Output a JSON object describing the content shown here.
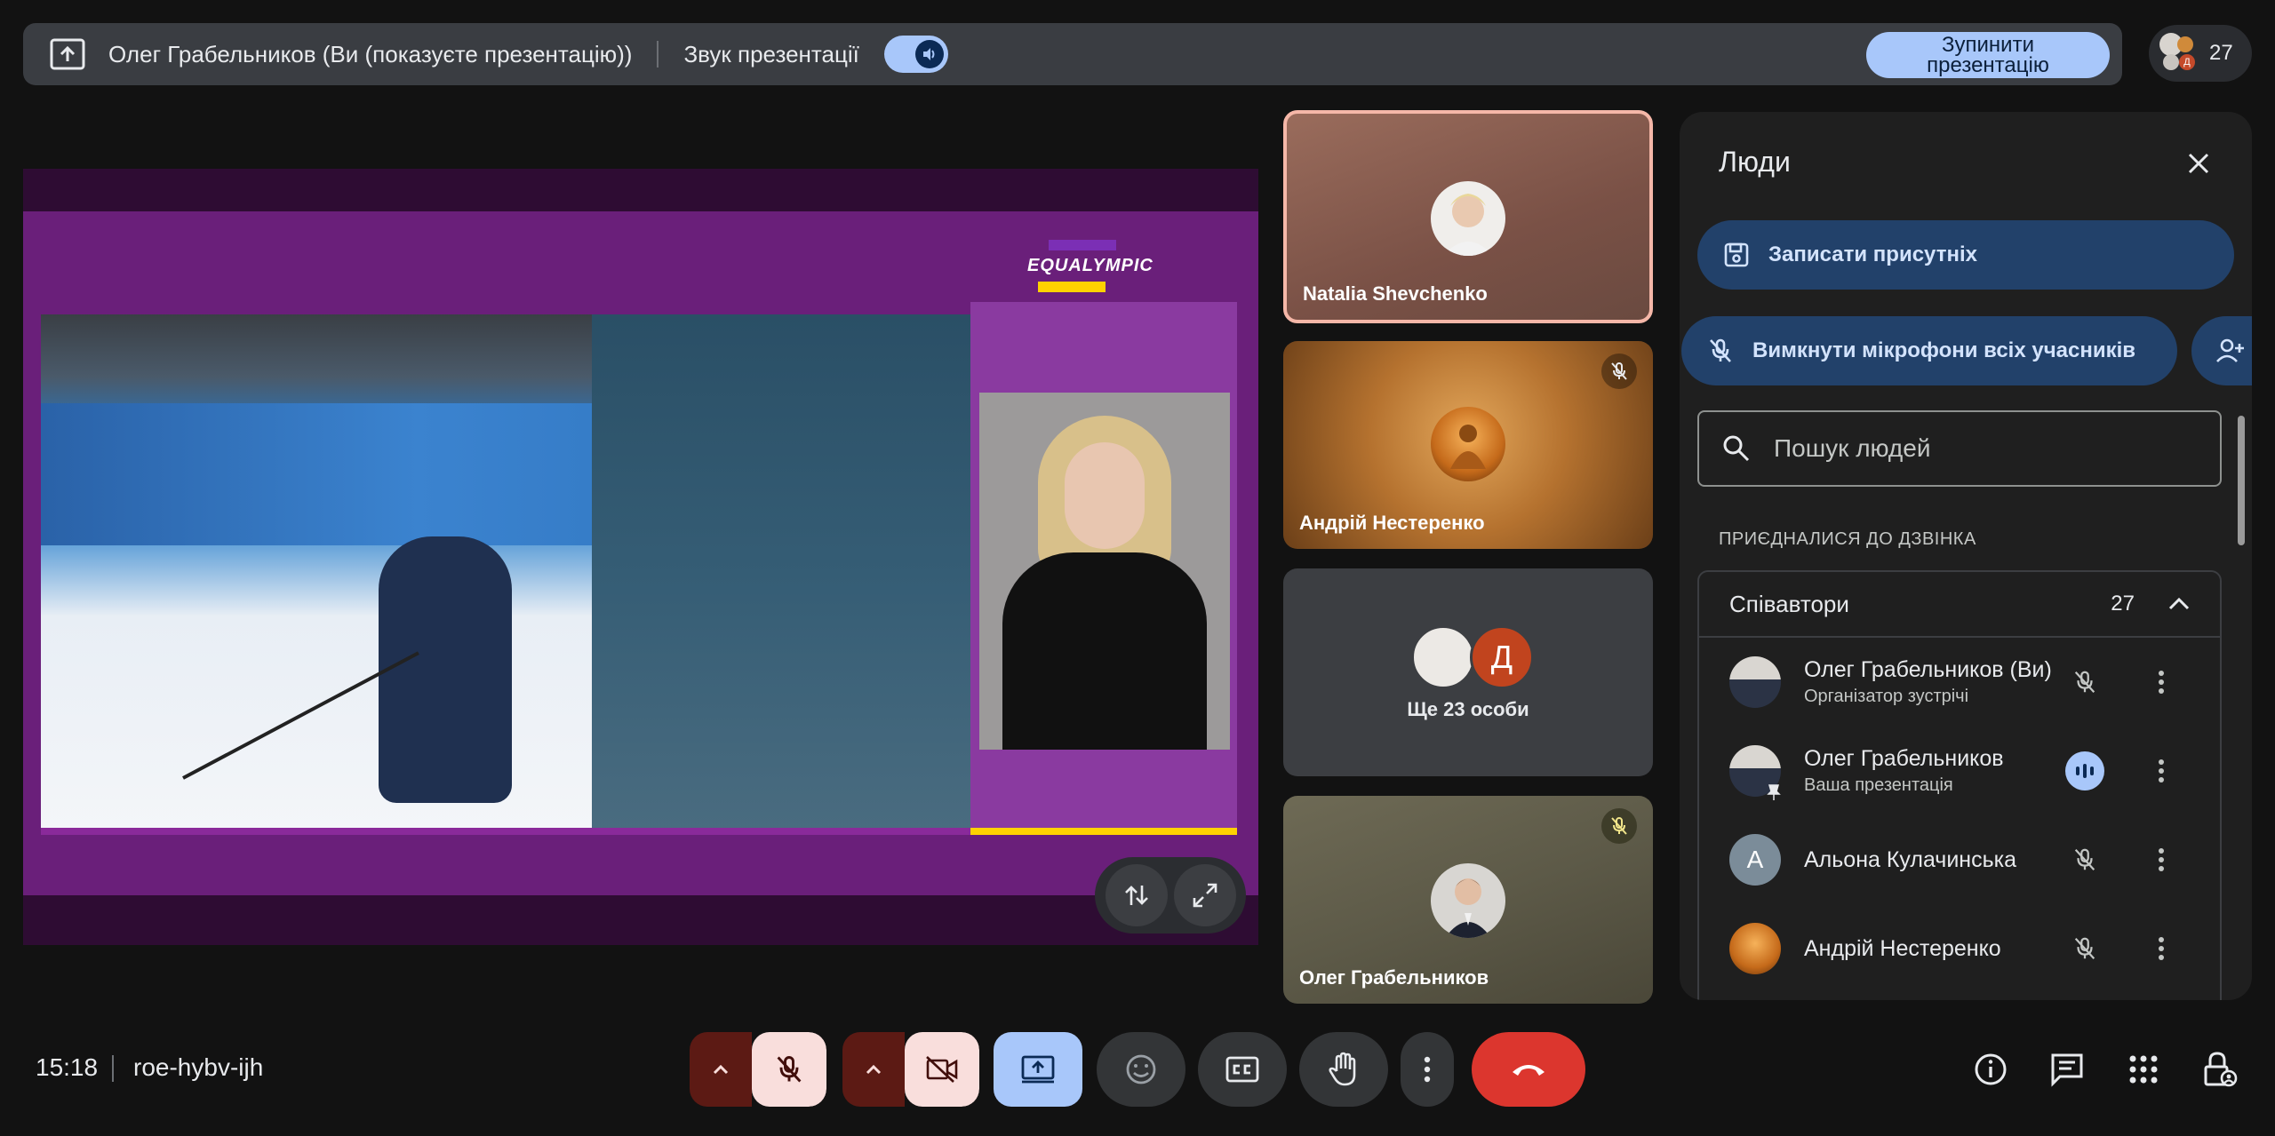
{
  "topbar": {
    "presenting_title": "Олег Грабельников (Ви (показуєте презентацію))",
    "sound_label": "Звук презентації",
    "stop_button": "Зупинити презентацію",
    "participant_count": "27"
  },
  "stage": {
    "logo_text": "EQUALYMPIC"
  },
  "tiles": {
    "t1_name": "Natalia Shevchenko",
    "t2_name": "Андрій Нестеренко",
    "t3_more": "Ще 23 особи",
    "t3_initial": "Д",
    "t4_name": "Олег Грабельников"
  },
  "panel": {
    "title": "Люди",
    "record_button": "Записати присутніх",
    "mute_all_button": "Вимкнути мікрофони всіх учасників",
    "search_placeholder": "Пошук людей",
    "section_label": "ПРИЄДНАЛИСЯ ДО ДЗВІНКА",
    "group_name": "Співавтори",
    "group_count": "27",
    "participants": [
      {
        "name": "Олег Грабельников (Ви)",
        "sub": "Організатор зустрічі",
        "initial": ""
      },
      {
        "name": "Олег Грабельников",
        "sub": "Ваша презентація",
        "initial": ""
      },
      {
        "name": "Альона Кулачинська",
        "sub": "",
        "initial": "А"
      },
      {
        "name": "Андрій Нестеренко",
        "sub": "",
        "initial": ""
      }
    ]
  },
  "bottom": {
    "time": "15:18",
    "meeting_code": "roe-hybv-ijh"
  },
  "colors": {
    "accent": "#a8c7fa",
    "end_call": "#dc362e",
    "muted_bg": "#f9dedc",
    "panel_button": "#22416a"
  }
}
